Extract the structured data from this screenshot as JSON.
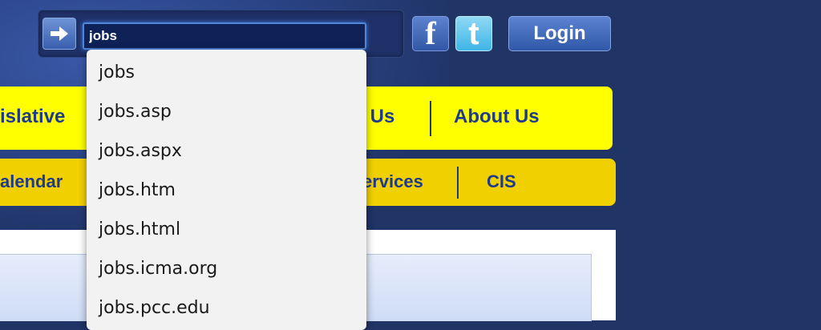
{
  "search": {
    "value": "jobs",
    "suggestions": [
      "jobs",
      "jobs.asp",
      "jobs.aspx",
      "jobs.htm",
      "jobs.html",
      "jobs.icma.org",
      "jobs.pcc.edu"
    ]
  },
  "header": {
    "go_icon": "arrow-right-icon",
    "facebook_icon_glyph": "f",
    "twitter_icon_glyph": "t",
    "login_label": "Login"
  },
  "nav_primary": {
    "items": [
      "islative",
      "t Us",
      "About Us"
    ]
  },
  "nav_secondary": {
    "items": [
      "alendar",
      "ervices",
      "CIS"
    ]
  },
  "colors": {
    "background": "#203466",
    "nav_primary": "#ffff00",
    "nav_secondary": "#f0d000",
    "nav_text": "#1e3a8c"
  }
}
